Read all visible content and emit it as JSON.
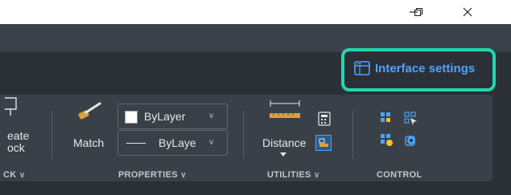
{
  "window_controls": {
    "minimize": "–",
    "restore": "❐",
    "close": "✕"
  },
  "interface_settings": {
    "label": "Interface settings"
  },
  "panels": {
    "block": {
      "create_label_1": "eate",
      "create_label_2": "ock",
      "title": "CK",
      "chevron": "∨"
    },
    "properties": {
      "title": "PROPERTIES",
      "chevron": "∨",
      "match_label": "Match",
      "color_value": "ByLayer",
      "linetype_value": "ByLaye",
      "dropdown_chevron": "∨"
    },
    "utilities": {
      "title": "UTILITIES",
      "chevron": "∨",
      "distance_label": "Distance"
    },
    "control": {
      "title": "CONTROL"
    }
  },
  "colors": {
    "accent_highlight": "#21d7b0",
    "link_blue": "#4ea3ff",
    "ribbon_bg": "#3a4047",
    "dark_bg": "#2b3037"
  }
}
